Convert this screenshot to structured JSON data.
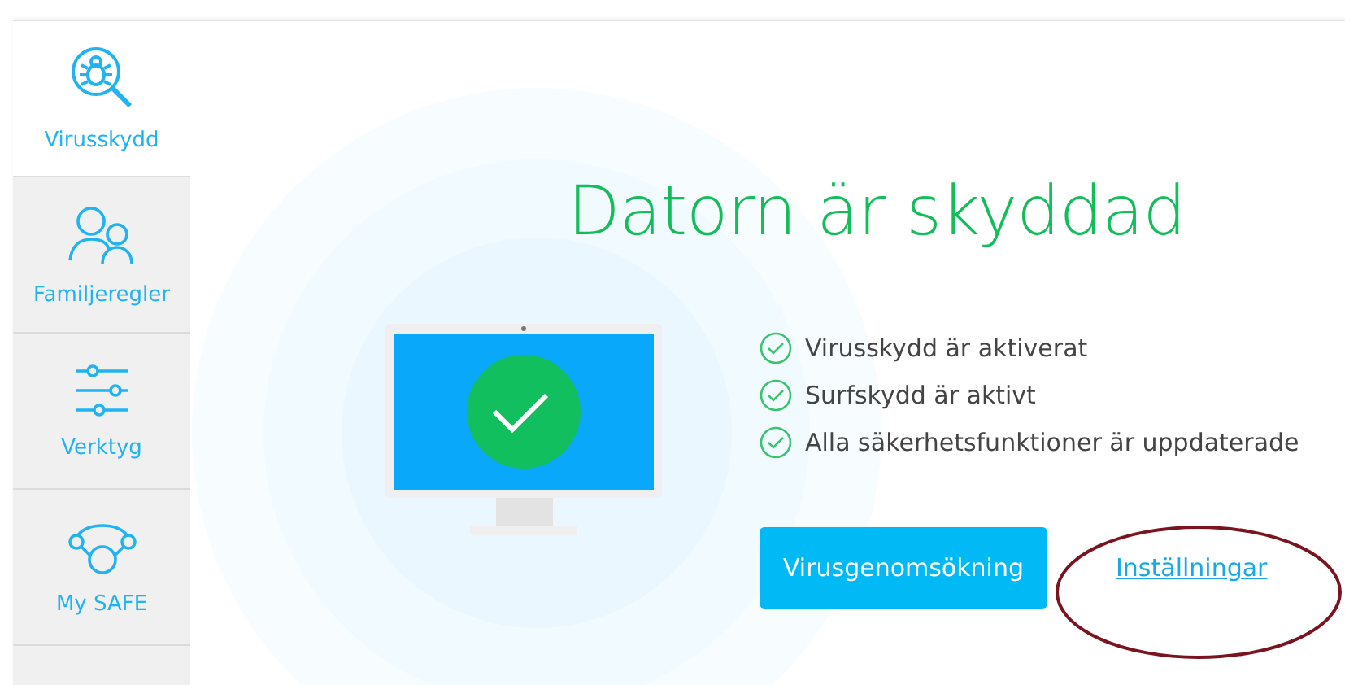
{
  "sidebar": {
    "items": [
      {
        "kind": "virus",
        "label": "Virusskydd",
        "selected": true
      },
      {
        "kind": "family",
        "label": "Familjeregler",
        "selected": false
      },
      {
        "kind": "tools",
        "label": "Verktyg",
        "selected": false
      },
      {
        "kind": "safe",
        "label": "My SAFE",
        "selected": false
      }
    ]
  },
  "status": {
    "title": "Datorn är skyddad",
    "checks": [
      {
        "text": "Virusskydd är aktiverat"
      },
      {
        "text": "Surfskydd är aktivt"
      },
      {
        "text": "Alla säkerhetsfunktioner är uppdaterade"
      }
    ]
  },
  "actions": {
    "button": "Virusgenomsökning",
    "link": "Inställningar"
  }
}
